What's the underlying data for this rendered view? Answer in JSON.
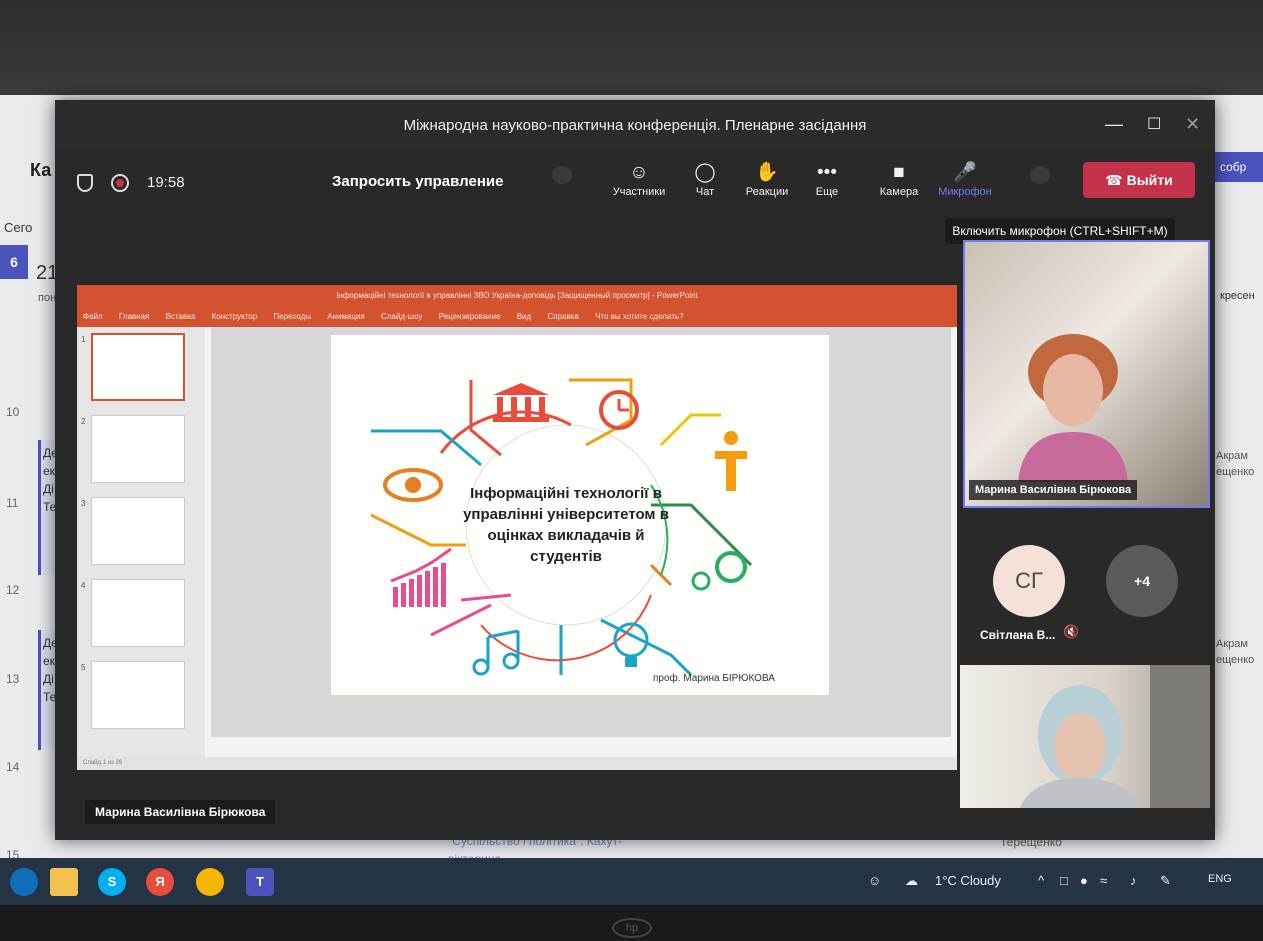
{
  "meeting": {
    "title": "Міжнародна науково-практична конференція. Пленарне засідання",
    "timer": "19:58",
    "take_control": "Запросить управление",
    "toolbar": {
      "participants": "Участники",
      "chat": "Чат",
      "reactions": "Реакции",
      "more": "Еще",
      "camera": "Камера",
      "mic": "Микрофон"
    },
    "leave": "Выйти",
    "mic_tooltip": "Включить микрофон (CTRL+SHIFT+M)"
  },
  "window_controls": {
    "minimize": "—",
    "maximize": "☐",
    "close": "✕"
  },
  "shared_screen": {
    "ppt_title": "Інформаційні технології в управлінні ЗВО Україна-доповідь [Защищенный просмотр] - PowerPoint",
    "ppt_menu": [
      "Файл",
      "Главная",
      "Вставка",
      "Конструктор",
      "Переходы",
      "Анимация",
      "Слайд-шоу",
      "Рецензирование",
      "Вид",
      "Справка",
      "Что вы хотите сделать?"
    ],
    "slide_numbers": [
      "1",
      "2",
      "3",
      "4",
      "5"
    ],
    "slide_title": "Інформаційні технології в управлінні університетом в оцінках викладачів й студентів",
    "slide_author": "проф. Марина БІРЮКОВА",
    "status": "Слайд 1 из 26",
    "presenter": "Марина Василівна Бірюкова"
  },
  "participants": {
    "main_speaker": "Марина Василівна Бірюкова",
    "sg_initials": "СГ",
    "sg_name": "Світлана В...",
    "more_count": "+4"
  },
  "desktop": {
    "cal_app_letter": "Ка",
    "today": "Сего",
    "date_num": "21",
    "day": "пон",
    "hours": [
      "10",
      "11",
      "12",
      "13",
      "14",
      "15"
    ],
    "event1": "Дер екс Ді Тер",
    "event2": "Дер екс Ді Тер",
    "right_join": "собр",
    "right_day": "кресен",
    "right_names": [
      "Акрам ещенко",
      "Акрам ещенко"
    ],
    "bottom_event": "\"Суспільство і політика\". Кахут-вікторина",
    "bottom_right": "Діна Акрамівна Терещенко"
  },
  "taskbar": {
    "weather": "1°C Cloudy",
    "lang": "ENG",
    "apps": [
      "S",
      "Я",
      "",
      "T"
    ]
  },
  "colors": {
    "teams_bg": "#292929",
    "accent": "#6f7bf7",
    "leave": "#c4314b",
    "ppt": "#d35230"
  }
}
